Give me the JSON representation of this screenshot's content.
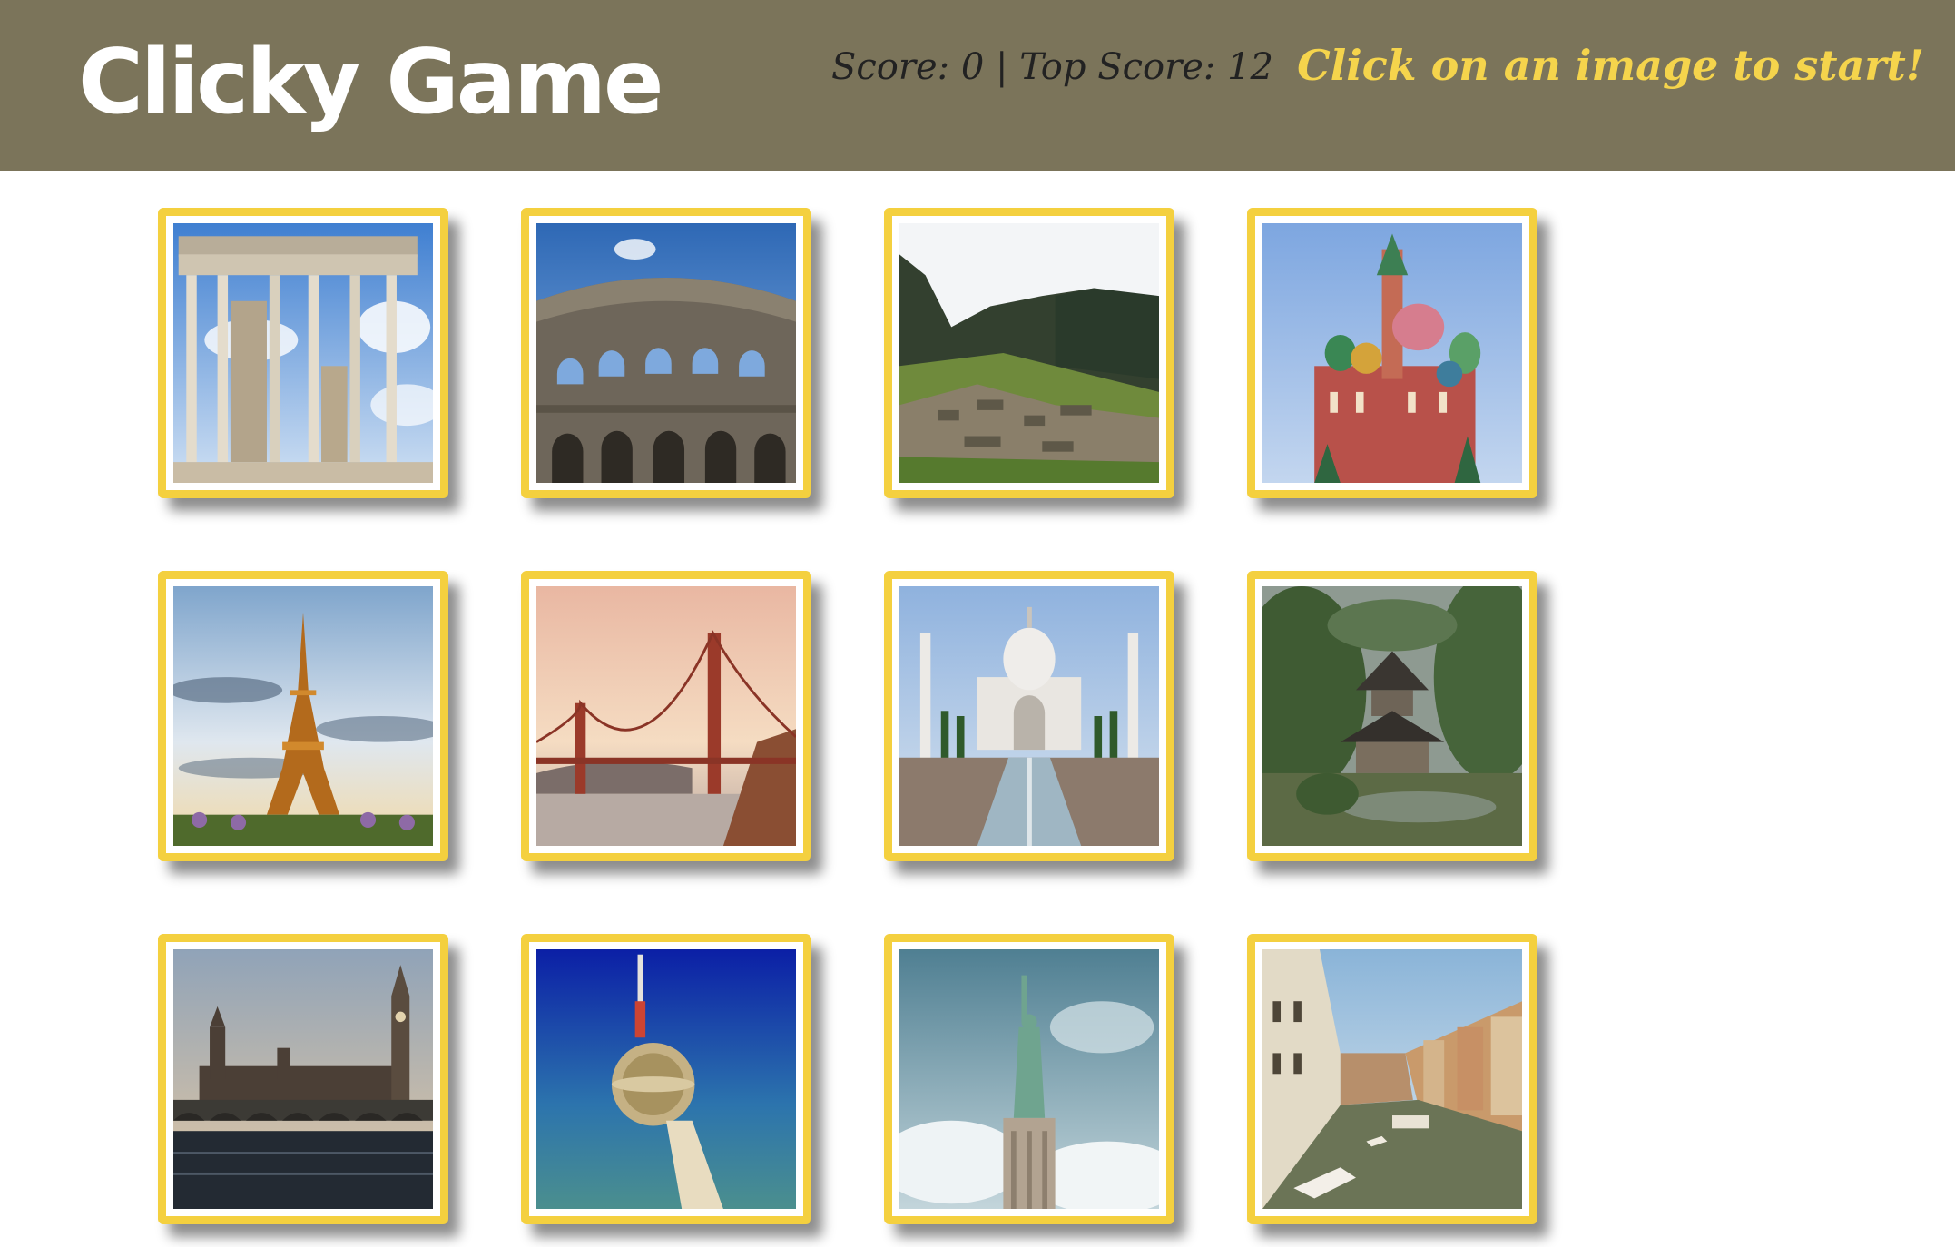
{
  "navbar": {
    "title": "Clicky Game",
    "score_text": "Score: 0 | Top Score: 12",
    "message": "Click on an image to start!"
  },
  "colors": {
    "navbar_bg": "#7b745a",
    "title": "#ffffff",
    "score": "#222222",
    "message": "#f5d44c",
    "card_frame": "#f4d03f"
  },
  "cards": [
    {
      "name": "parthenon-card",
      "image": "parthenon-image"
    },
    {
      "name": "colosseum-card",
      "image": "colosseum-image"
    },
    {
      "name": "machu-picchu-card",
      "image": "machu-picchu-image"
    },
    {
      "name": "saint-basils-cathedral-card",
      "image": "saint-basils-cathedral-image"
    },
    {
      "name": "eiffel-tower-card",
      "image": "eiffel-tower-image"
    },
    {
      "name": "golden-gate-bridge-card",
      "image": "golden-gate-bridge-image"
    },
    {
      "name": "taj-mahal-card",
      "image": "taj-mahal-image"
    },
    {
      "name": "japanese-pagoda-card",
      "image": "japanese-pagoda-image"
    },
    {
      "name": "big-ben-card",
      "image": "big-ben-image"
    },
    {
      "name": "berlin-tv-tower-card",
      "image": "berlin-tv-tower-image"
    },
    {
      "name": "statue-of-liberty-card",
      "image": "statue-of-liberty-image"
    },
    {
      "name": "venice-canal-card",
      "image": "venice-canal-image"
    }
  ]
}
